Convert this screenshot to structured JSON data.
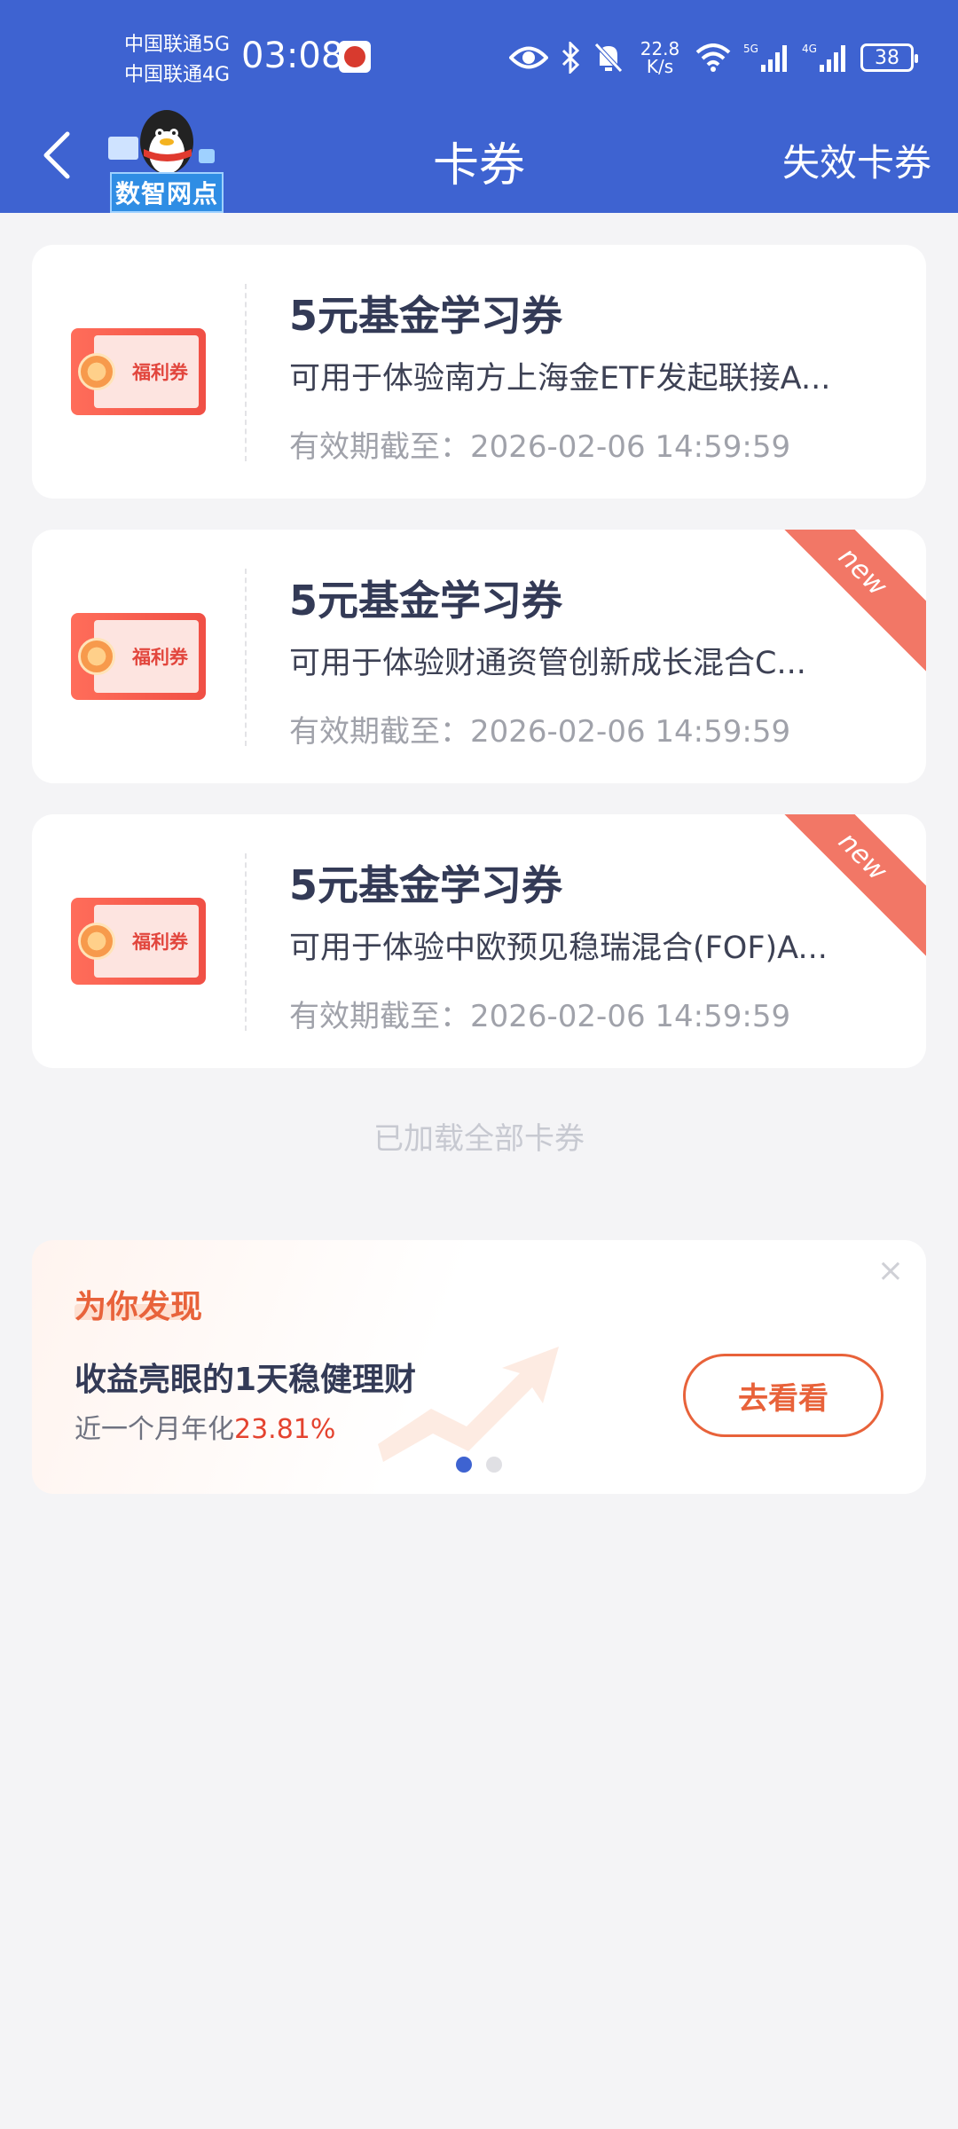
{
  "status_bar": {
    "carrier1": "中国联通5G",
    "carrier2": "中国联通4G",
    "time": "03:08",
    "net_speed_value": "22.8",
    "net_speed_unit": "K/s",
    "signal1_label": "5G",
    "signal2_label": "4G",
    "battery": "38"
  },
  "nav": {
    "mascot_label": "数智网点",
    "title": "卡券",
    "expired_link": "失效卡券"
  },
  "coupons": [
    {
      "badge": "福利券",
      "title": "5元基金学习券",
      "desc": "可用于体验南方上海金ETF发起联接A...",
      "expiry": "有效期截至：2026-02-06 14:59:59",
      "is_new": false
    },
    {
      "badge": "福利券",
      "title": "5元基金学习券",
      "desc": "可用于体验财通资管创新成长混合C...",
      "expiry": "有效期截至：2026-02-06 14:59:59",
      "is_new": true,
      "new_label": "new"
    },
    {
      "badge": "福利券",
      "title": "5元基金学习券",
      "desc": "可用于体验中欧预见稳瑞混合(FOF)A...",
      "expiry": "有效期截至：2026-02-06 14:59:59",
      "is_new": true,
      "new_label": "new"
    }
  ],
  "footer_note": "已加载全部卡券",
  "promo": {
    "tag": "为你发现",
    "title": "收益亮眼的1天稳健理财",
    "sub_prefix": "近一个月年化",
    "sub_rate": "23.81%",
    "button": "去看看",
    "close_icon": "×",
    "dots": 2,
    "active_dot": 0
  },
  "colors": {
    "header_bg": "#3e63d1",
    "accent_orange": "#e8623a",
    "rate_red": "#e4432f",
    "new_ribbon": "#f27766"
  }
}
